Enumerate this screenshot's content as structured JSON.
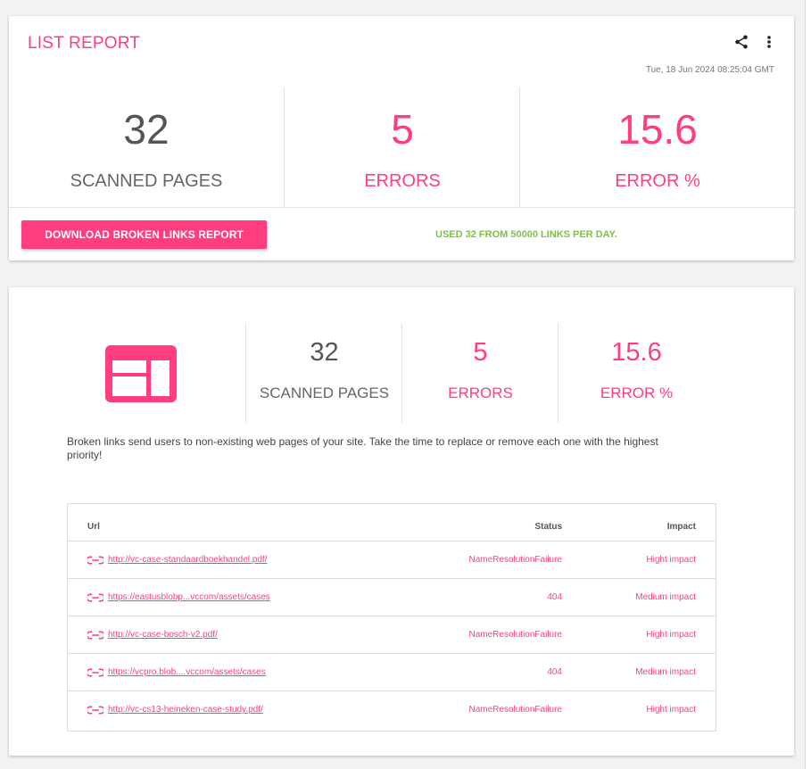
{
  "report": {
    "title": "LIST REPORT",
    "timestamp": "Tue, 18 Jun 2024 08:25:04 GMT",
    "share_icon": "share-icon",
    "more_icon": "more-vert-icon",
    "stats": {
      "scanned_pages_value": "32",
      "scanned_pages_label": "SCANNED PAGES",
      "errors_value": "5",
      "errors_label": "ERRORS",
      "error_pct_value": "15.6",
      "error_pct_label": "ERROR %"
    },
    "download_label": "DOWNLOAD BROKEN LINKS REPORT",
    "usage_text": "USED 32 FROM 50000 LINKS PER DAY."
  },
  "broken_links": {
    "icon": "web-layout-icon",
    "stats": {
      "scanned_pages_value": "32",
      "scanned_pages_label": "SCANNED PAGES",
      "errors_value": "5",
      "errors_label": "ERRORS",
      "error_pct_value": "15.6",
      "error_pct_label": "ERROR %"
    },
    "description": "Broken links send users to non-existing web pages of your site. Take the time to replace or remove each one with the highest priority!",
    "table": {
      "headers": {
        "url": "Url",
        "status": "Status",
        "impact": "Impact"
      },
      "rows": [
        {
          "url": "http://vc-case-standaardboekhandel.pdf/",
          "status": "NameResolutionFailure",
          "impact": "Hight impact"
        },
        {
          "url": "https://eastusblobp...vccom/assets/cases",
          "status": "404",
          "impact": "Medium impact"
        },
        {
          "url": "http://vc-case-bosch-v2.pdf/",
          "status": "NameResolutionFailure",
          "impact": "Hight impact"
        },
        {
          "url": "https://vcpro.blob....vccom/assets/cases",
          "status": "404",
          "impact": "Medium impact"
        },
        {
          "url": "http://vc-cs13-heineken-case-study.pdf/",
          "status": "NameResolutionFailure",
          "impact": "Hight impact"
        }
      ]
    }
  },
  "colors": {
    "accent": "#ff3d7f",
    "success": "#7dc242",
    "text_muted": "#555555"
  }
}
